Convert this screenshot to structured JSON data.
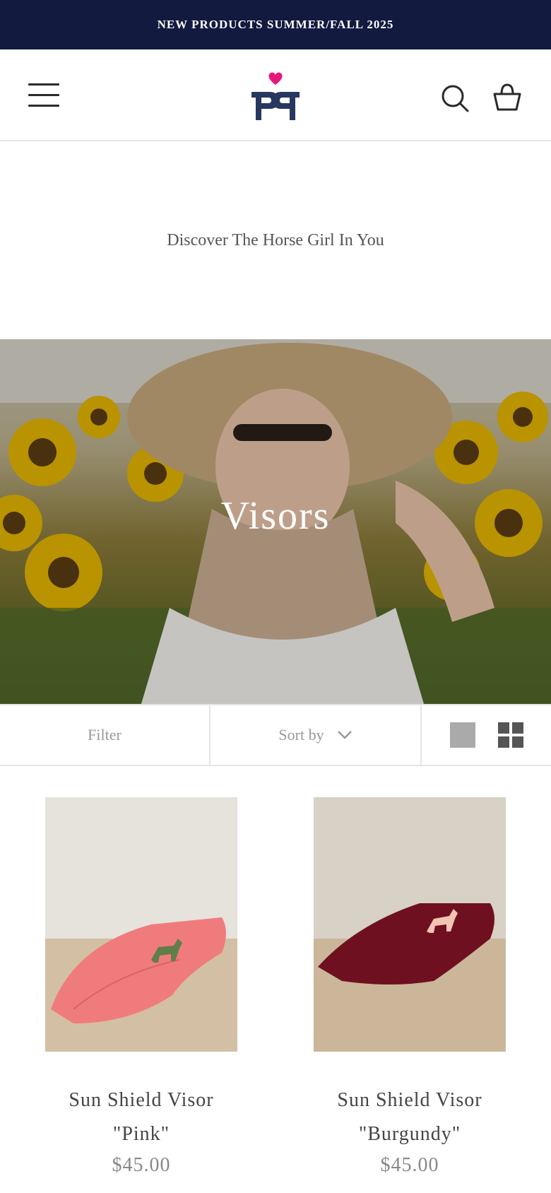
{
  "announcement": "NEW PRODUCTS SUMMER/FALL 2025",
  "header": {
    "menu_icon": "hamburger-menu-icon",
    "logo": "pp-heart-logo",
    "search_icon": "search-icon",
    "cart_icon": "shopping-bag-icon"
  },
  "tagline": "Discover The Horse Girl In You",
  "hero": {
    "title": "Visors"
  },
  "toolbar": {
    "filter_label": "Filter",
    "sort_label": "Sort by",
    "view_icons": [
      "single-column-view-icon",
      "grid-view-icon"
    ]
  },
  "products": [
    {
      "title": "Sun Shield Visor \"Pink\"",
      "price": "$45.00",
      "visor_color": "#f07b7d",
      "horse_color": "#5f7f48"
    },
    {
      "title": "Sun Shield Visor \"Burgundy\"",
      "price": "$45.00",
      "visor_color": "#6e1020",
      "horse_color": "#f1c3b4"
    }
  ],
  "colors": {
    "announcement_bg": "#131a40",
    "logo_heart": "#e8177b",
    "logo_letters": "#263760"
  }
}
